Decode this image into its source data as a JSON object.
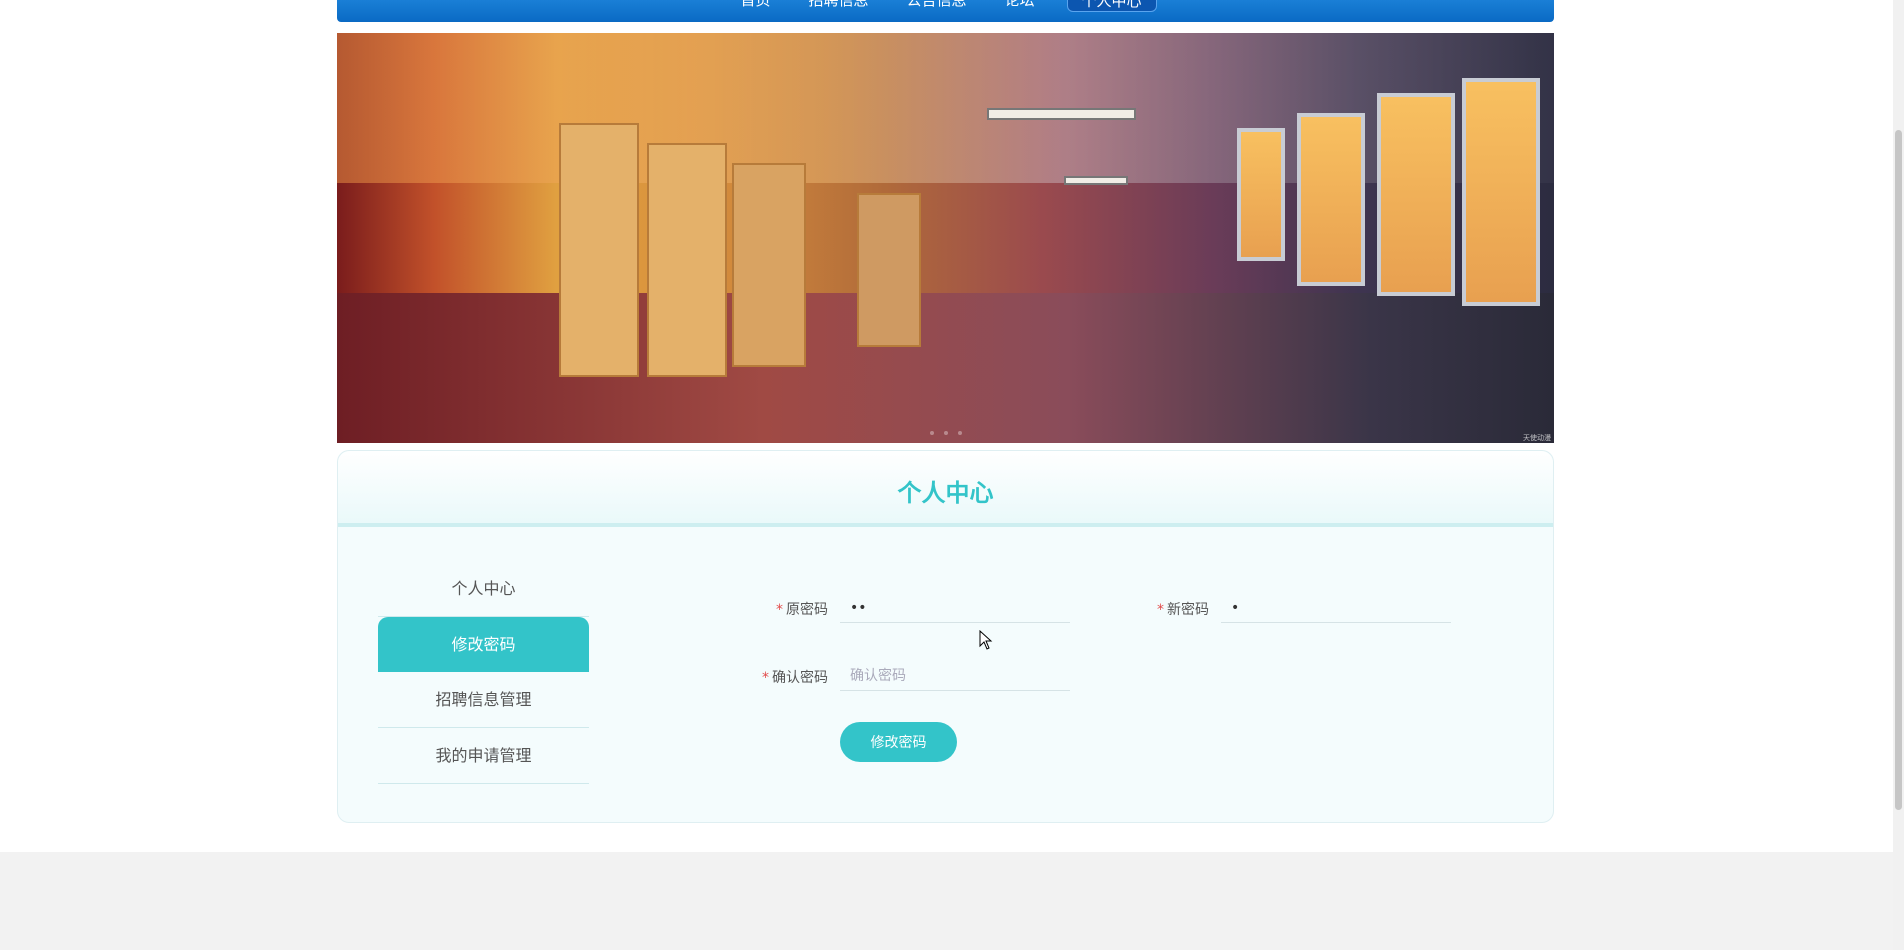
{
  "nav": {
    "items": [
      "首页",
      "招聘信息",
      "公告信息",
      "论坛",
      "个人中心"
    ],
    "active_index": 4
  },
  "banner": {
    "watermark": "天使动漫"
  },
  "panel": {
    "title": "个人中心"
  },
  "sidebar": {
    "items": [
      {
        "label": "个人中心",
        "active": false
      },
      {
        "label": "修改密码",
        "active": true
      },
      {
        "label": "招聘信息管理",
        "active": false
      },
      {
        "label": "我的申请管理",
        "active": false
      }
    ]
  },
  "form": {
    "old_password": {
      "label": "原密码",
      "value": "••"
    },
    "new_password": {
      "label": "新密码",
      "value": "•"
    },
    "confirm_password": {
      "label": "确认密码",
      "placeholder": "确认密码",
      "value": ""
    },
    "required_mark": "*",
    "submit_label": "修改密码"
  },
  "colors": {
    "accent": "#33c4c9",
    "nav": "#0a6ac4",
    "required": "#e24b4b"
  }
}
